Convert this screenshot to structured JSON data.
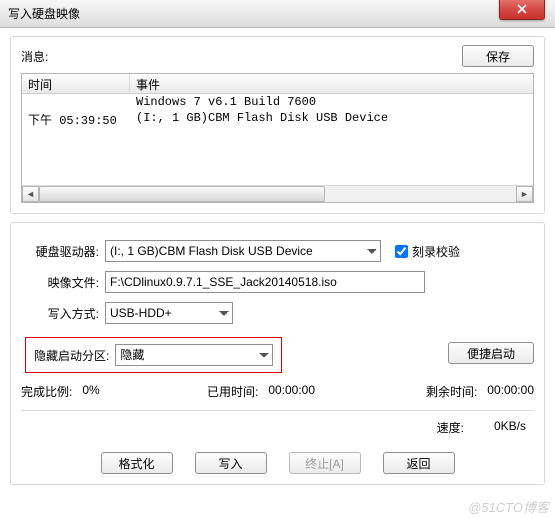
{
  "window": {
    "title": "写入硬盘映像"
  },
  "top": {
    "message_label": "消息:",
    "save_button": "保存"
  },
  "log": {
    "col_time": "时间",
    "col_event": "事件",
    "rows": [
      {
        "time": "",
        "event": "Windows 7 v6.1 Build 7600"
      },
      {
        "time": "下午 05:39:50",
        "event": "(I:, 1 GB)CBM Flash Disk USB Device"
      }
    ]
  },
  "form": {
    "drive_label": "硬盘驱动器:",
    "drive_value": "(I:, 1 GB)CBM Flash Disk USB Device",
    "burn_verify_label": "刻录校验",
    "burn_verify_checked": true,
    "image_label": "映像文件:",
    "image_value": "F:\\CDlinux0.9.7.1_SSE_Jack20140518.iso",
    "write_mode_label": "写入方式:",
    "write_mode_value": "USB-HDD+",
    "hidden_part_label": "隐藏启动分区:",
    "hidden_part_value": "隐藏",
    "convenient_boot_button": "便捷启动"
  },
  "status": {
    "percent_label": "完成比例:",
    "percent_value": "0%",
    "elapsed_label": "已用时间:",
    "elapsed_value": "00:00:00",
    "remain_label": "剩余时间:",
    "remain_value": "00:00:00",
    "speed_label": "速度:",
    "speed_value": "0KB/s"
  },
  "buttons": {
    "format": "格式化",
    "write": "写入",
    "abort": "终止[A]",
    "back": "返回"
  },
  "watermark": "@51CTO博客"
}
